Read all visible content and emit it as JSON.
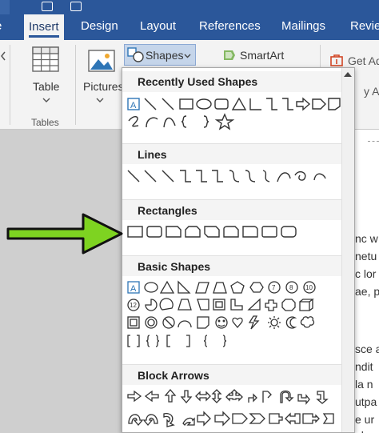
{
  "ribbon": {
    "tabs": [
      {
        "label": "e"
      },
      {
        "label": "Insert"
      },
      {
        "label": "Design"
      },
      {
        "label": "Layout"
      },
      {
        "label": "References"
      },
      {
        "label": "Mailings"
      },
      {
        "label": "Revie"
      }
    ],
    "table_label": "Table",
    "tables_group_label": "Tables",
    "pictures_label": "Pictures",
    "shapes_label": "Shapes",
    "smartart_label": "SmartArt",
    "get_addins_label": "Get Ad",
    "my_addins_label": "y Ad"
  },
  "shapes_panel": {
    "sections": {
      "recent": "Recently Used Shapes",
      "lines": "Lines",
      "rectangles": "Rectangles",
      "basic": "Basic Shapes",
      "block_arrows": "Block Arrows"
    }
  },
  "document": {
    "lines": [
      "nc w",
      "netu",
      "c lor",
      "ae, p",
      "",
      "sce a",
      "ndit",
      "la n",
      "utpa",
      "e ur",
      "elen"
    ]
  },
  "colors": {
    "ribbon_blue": "#2b579a",
    "annotation_green": "#7ed321",
    "selected_shape_blue": "#2e75b6"
  }
}
